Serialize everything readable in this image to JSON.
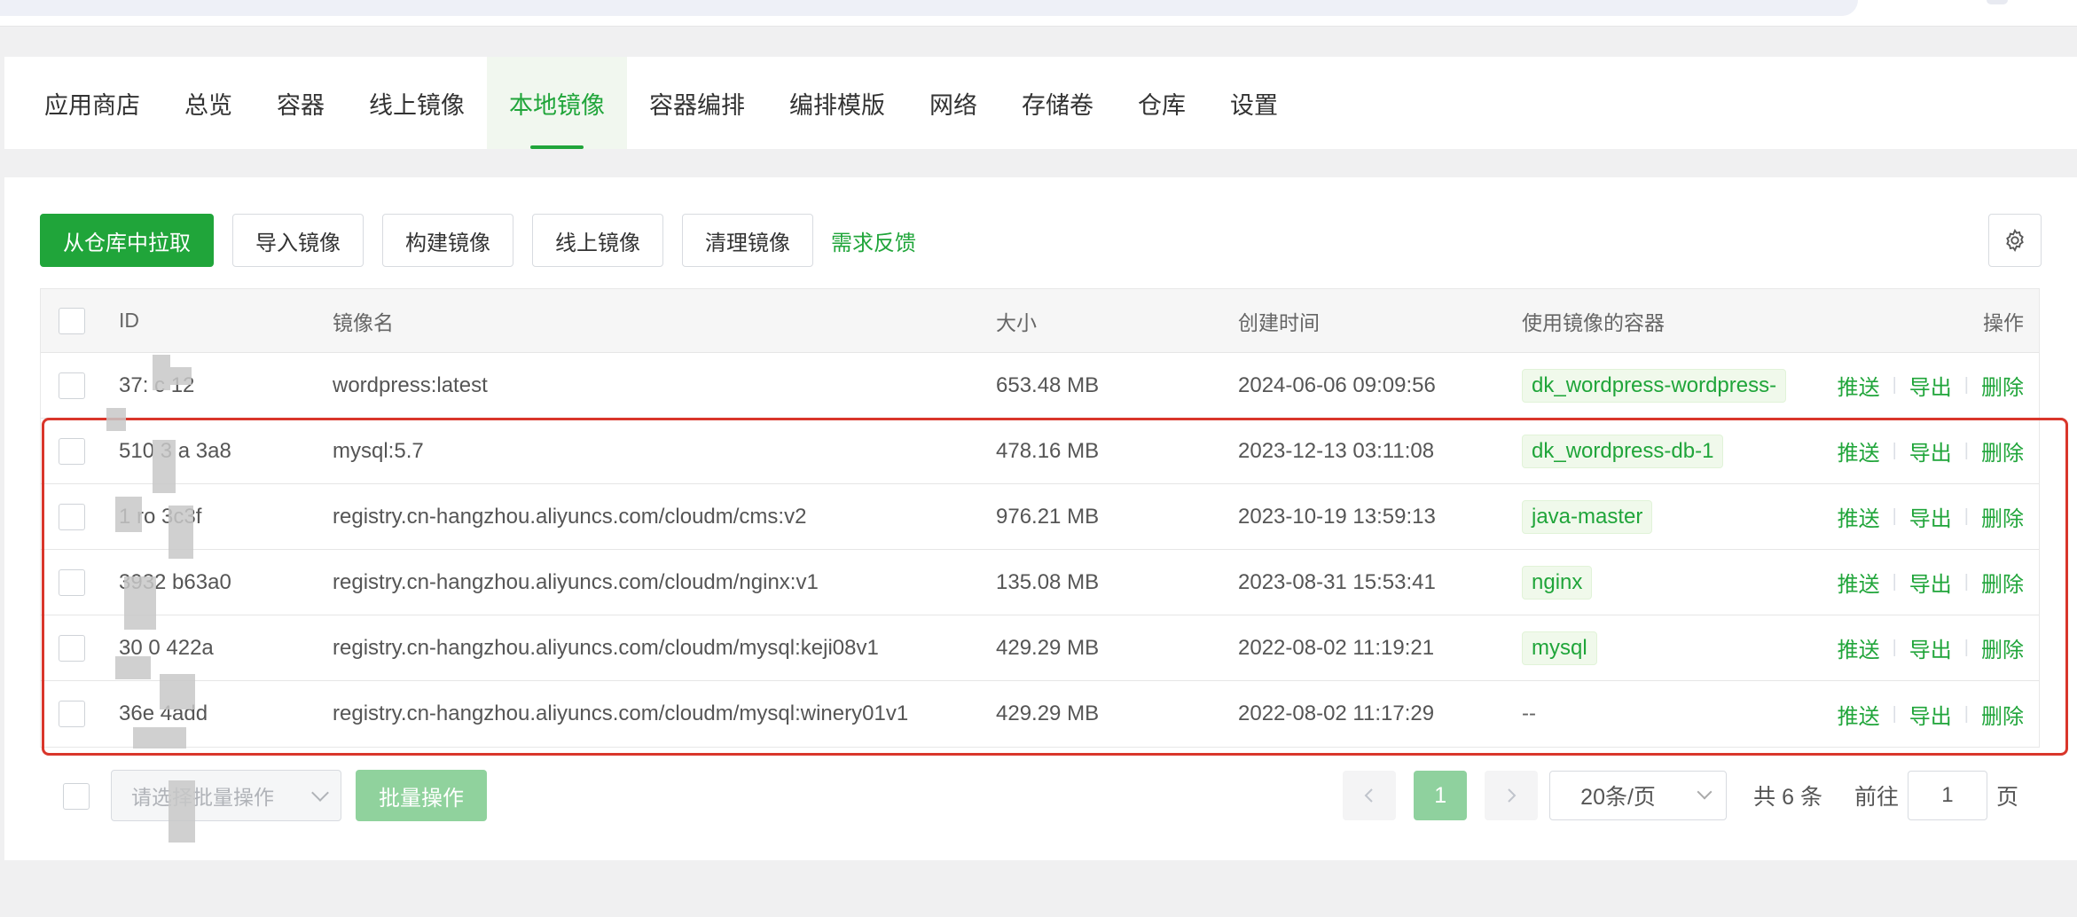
{
  "tabs": [
    {
      "label": "应用商店",
      "active": false
    },
    {
      "label": "总览",
      "active": false
    },
    {
      "label": "容器",
      "active": false
    },
    {
      "label": "线上镜像",
      "active": false
    },
    {
      "label": "本地镜像",
      "active": true
    },
    {
      "label": "容器编排",
      "active": false
    },
    {
      "label": "编排模版",
      "active": false
    },
    {
      "label": "网络",
      "active": false
    },
    {
      "label": "存储卷",
      "active": false
    },
    {
      "label": "仓库",
      "active": false
    },
    {
      "label": "设置",
      "active": false
    }
  ],
  "toolbar": {
    "pull_label": "从仓库中拉取",
    "import_label": "导入镜像",
    "build_label": "构建镜像",
    "online_label": "线上镜像",
    "clean_label": "清理镜像",
    "feedback_label": "需求反馈"
  },
  "table": {
    "headers": {
      "id": "ID",
      "name": "镜像名",
      "size": "大小",
      "created": "创建时间",
      "containers": "使用镜像的容器",
      "ops": "操作"
    },
    "rows": [
      {
        "id": "37:  c   12",
        "name": "wordpress:latest",
        "size": "653.48 MB",
        "created": "2024-06-06 09:09:56",
        "container": "dk_wordpress-wordpress-",
        "clip": true
      },
      {
        "id": "510  3  a  3a8",
        "name": "mysql:5.7",
        "size": "478.16 MB",
        "created": "2023-12-13 03:11:08",
        "container": "dk_wordpress-db-1",
        "clip": false
      },
      {
        "id": "1  ro     3c3f",
        "name": "registry.cn-hangzhou.aliyuncs.com/cloudm/cms:v2",
        "size": "976.21 MB",
        "created": "2023-10-19 13:59:13",
        "container": "java-master",
        "clip": false
      },
      {
        "id": "3932   b63a0",
        "name": "registry.cn-hangzhou.aliyuncs.com/cloudm/nginx:v1",
        "size": "135.08 MB",
        "created": "2023-08-31 15:53:41",
        "container": "nginx",
        "clip": false
      },
      {
        "id": "30  0   422a",
        "name": "registry.cn-hangzhou.aliyuncs.com/cloudm/mysql:keji08v1",
        "size": "429.29 MB",
        "created": "2022-08-02 11:19:21",
        "container": "mysql",
        "clip": false
      },
      {
        "id": "36e   4add",
        "name": "registry.cn-hangzhou.aliyuncs.com/cloudm/mysql:winery01v1",
        "size": "429.29 MB",
        "created": "2022-08-02 11:17:29",
        "container": "--",
        "clip": false
      }
    ],
    "ops": {
      "push": "推送",
      "export": "导出",
      "delete": "删除"
    }
  },
  "footer": {
    "batch_placeholder": "请选择批量操作",
    "batch_button": "批量操作",
    "current_page": "1",
    "page_size": "20条/页",
    "total": "共 6 条",
    "goto_label": "前往",
    "goto_value": "1",
    "goto_suffix": "页"
  },
  "colors": {
    "accent": "#20a53a",
    "highlight": "#d9362b"
  }
}
